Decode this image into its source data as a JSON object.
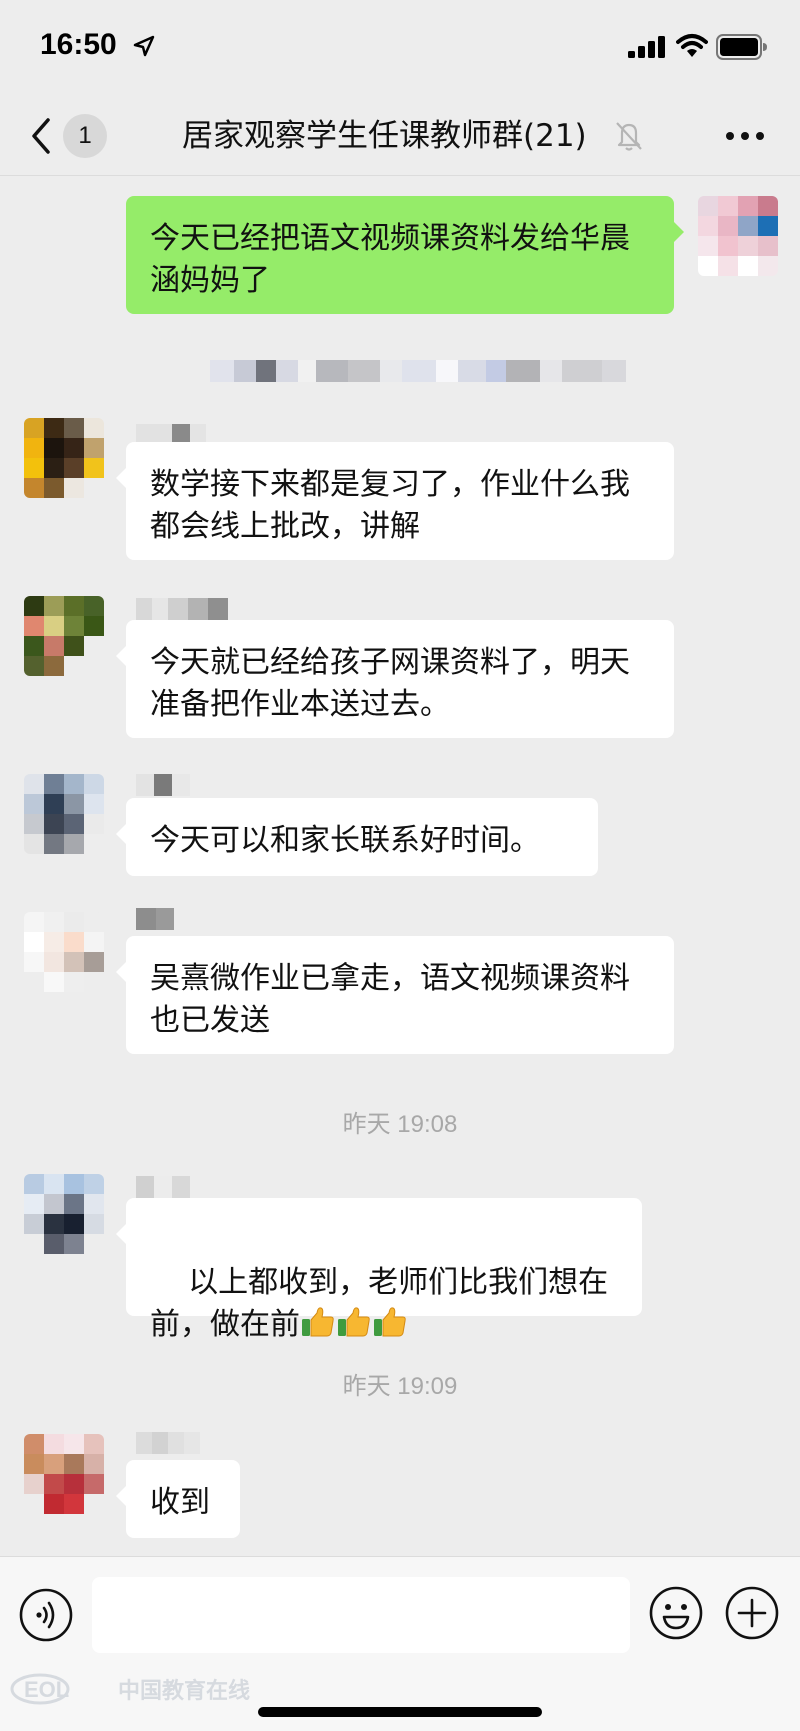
{
  "status_bar": {
    "time": "16:50",
    "icons": [
      "location-arrow-icon",
      "signal-icon",
      "wifi-icon",
      "battery-icon"
    ]
  },
  "nav": {
    "back_icon": "chevron-left-icon",
    "unread_count": "1",
    "title": "居家观察学生任课教师群(21)",
    "mute_icon": "bell-mute-icon",
    "more_icon": "more-dots-icon"
  },
  "messages": [
    {
      "side": "right",
      "text": "今天已经把语文视频课资料发给华晨涵妈妈了"
    },
    {
      "side": "left",
      "text": "数学接下来都是复习了，作业什么我都会线上批改，讲解"
    },
    {
      "side": "left",
      "text": "今天就已经给孩子网课资料了，明天准备把作业本送过去。"
    },
    {
      "side": "left",
      "text": "今天可以和家长联系好时间。"
    },
    {
      "side": "left",
      "text": "吴熹微作业已拿走，语文视频课资料也已发送"
    },
    {
      "side": "left",
      "text": "以上都收到，老师们比我们想在前，做在前",
      "emoji": "thumbs-up-icon",
      "emoji_count": 3
    },
    {
      "side": "left",
      "text": "收到"
    }
  ],
  "timestamps": [
    "昨天 19:08",
    "昨天 19:09"
  ],
  "input_bar": {
    "voice_icon": "voice-icon",
    "placeholder": "",
    "emoji_icon": "smiley-icon",
    "plus_icon": "plus-circle-icon"
  },
  "watermark": {
    "text": "中国教育在线"
  },
  "colors": {
    "background": "#ededed",
    "my_bubble": "#95ec69",
    "other_bubble": "#ffffff",
    "timestamp": "#a8a8a8"
  }
}
